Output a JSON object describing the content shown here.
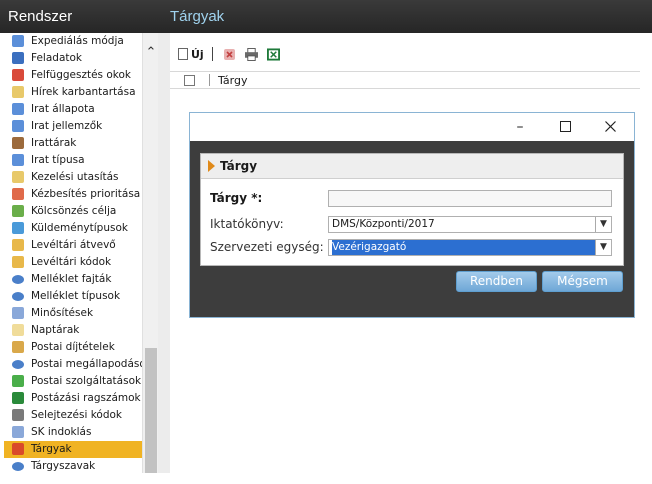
{
  "sidebar": {
    "title": "Rendszer",
    "items": [
      {
        "label": "Expediálás módja",
        "icon": "list-icon",
        "color": "#5b8fd9",
        "selected": false
      },
      {
        "label": "Feladatok",
        "icon": "tasks-icon",
        "color": "#3b6fbf",
        "selected": false
      },
      {
        "label": "Felfüggesztés okok",
        "icon": "lock-icon",
        "color": "#d94a3a",
        "selected": false
      },
      {
        "label": "Hírek karbantartása",
        "icon": "news-icon",
        "color": "#e8c96a",
        "selected": false
      },
      {
        "label": "Irat állapota",
        "icon": "document-icon",
        "color": "#5b8fd9",
        "selected": false
      },
      {
        "label": "Irat jellemzők",
        "icon": "document-icon",
        "color": "#5b8fd9",
        "selected": false
      },
      {
        "label": "Irattárak",
        "icon": "archive-icon",
        "color": "#9c6a3c",
        "selected": false
      },
      {
        "label": "Irat típusa",
        "icon": "document-icon",
        "color": "#5b8fd9",
        "selected": false
      },
      {
        "label": "Kezelési utasítás",
        "icon": "note-icon",
        "color": "#e8c96a",
        "selected": false
      },
      {
        "label": "Kézbesítés prioritása",
        "icon": "calendar-icon",
        "color": "#e06a4a",
        "selected": false
      },
      {
        "label": "Kölcsönzés célja",
        "icon": "exchange-icon",
        "color": "#6aae4a",
        "selected": false
      },
      {
        "label": "Küldeménytípusok",
        "icon": "envelope-icon",
        "color": "#4a9ad9",
        "selected": false
      },
      {
        "label": "Levéltári átvevő",
        "icon": "folder-icon",
        "color": "#e8b84a",
        "selected": false
      },
      {
        "label": "Levéltári kódok",
        "icon": "folder-icon",
        "color": "#e8b84a",
        "selected": false
      },
      {
        "label": "Melléklet fajták",
        "icon": "ellipse-icon",
        "color": "#4a7fc9",
        "selected": false
      },
      {
        "label": "Melléklet típusok",
        "icon": "ellipse-icon",
        "color": "#4a7fc9",
        "selected": false
      },
      {
        "label": "Minősítések",
        "icon": "check-icon",
        "color": "#8aa8d9",
        "selected": false
      },
      {
        "label": "Naptárak",
        "icon": "note-icon",
        "color": "#f0dc9a",
        "selected": false
      },
      {
        "label": "Postai díjtételek",
        "icon": "stamp-icon",
        "color": "#d9a84a",
        "selected": false
      },
      {
        "label": "Postai megállapodások",
        "icon": "ellipse-icon",
        "color": "#4a7fc9",
        "selected": false
      },
      {
        "label": "Postai szolgáltatások",
        "icon": "service-icon",
        "color": "#4aae4a",
        "selected": false
      },
      {
        "label": "Postázási ragszámok",
        "icon": "barcode-icon",
        "color": "#2a8a3a",
        "selected": false
      },
      {
        "label": "Selejtezési kódok",
        "icon": "trash-icon",
        "color": "#7a7a7a",
        "selected": false
      },
      {
        "label": "SK indoklás",
        "icon": "document-icon",
        "color": "#8aa8d9",
        "selected": false
      },
      {
        "label": "Tárgyak",
        "icon": "tag-icon",
        "color": "#d94a2a",
        "selected": true
      },
      {
        "label": "Tárgyszavak",
        "icon": "ellipse-icon",
        "color": "#4a7fc9",
        "selected": false
      }
    ]
  },
  "main": {
    "title": "Tárgyak",
    "toolbar": {
      "new_label": "Új"
    },
    "table": {
      "column_header": "Tárgy"
    }
  },
  "dialog": {
    "header": "Tárgy",
    "fields": {
      "subject_label": "Tárgy *:",
      "subject_value": "",
      "register_label": "Iktatókönyv:",
      "register_value": "DMS/Központi/2017",
      "unit_label": "Szervezeti egység:",
      "unit_value": "Vezérigazgató"
    },
    "ok_label": "Rendben",
    "cancel_label": "Mégsem"
  }
}
